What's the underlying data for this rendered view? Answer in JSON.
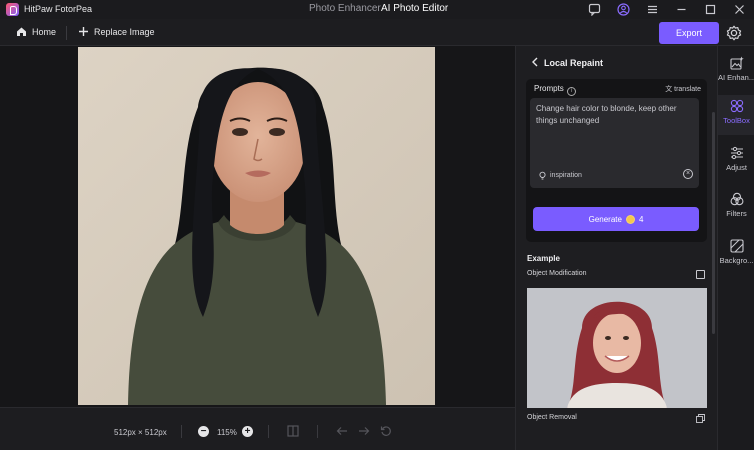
{
  "titlebar": {
    "app_name": "HitPaw FotorPea",
    "tabs": [
      {
        "label": "Photo Enhancer",
        "active": false
      },
      {
        "label": "AI Photo Editor",
        "active": true
      }
    ]
  },
  "toolbar": {
    "home_label": "Home",
    "replace_label": "Replace Image",
    "export_label": "Export"
  },
  "bottombar": {
    "dimensions": "512px × 512px",
    "zoom": "115%"
  },
  "panel": {
    "title": "Local Repaint",
    "prompts_label": "Prompts",
    "translate_label": "translate",
    "prompt_text": "Change hair color to blonde, keep other things unchanged",
    "inspiration_label": "inspiration",
    "generate_label": "Generate",
    "generate_cost": "4",
    "example_title": "Example",
    "example_1_label": "Object Modification",
    "example_2_label": "Object Removal"
  },
  "rail": {
    "items": [
      {
        "label": "AI Enhan...",
        "icon": "ai-enhance-icon",
        "active": false
      },
      {
        "label": "ToolBox",
        "icon": "toolbox-icon",
        "active": true
      },
      {
        "label": "Adjust",
        "icon": "adjust-icon",
        "active": false
      },
      {
        "label": "Filters",
        "icon": "filters-icon",
        "active": false
      },
      {
        "label": "Backgro...",
        "icon": "background-icon",
        "active": false
      }
    ]
  },
  "colors": {
    "accent": "#7a5cff",
    "background": "#141416",
    "panel": "#1e1e21"
  }
}
